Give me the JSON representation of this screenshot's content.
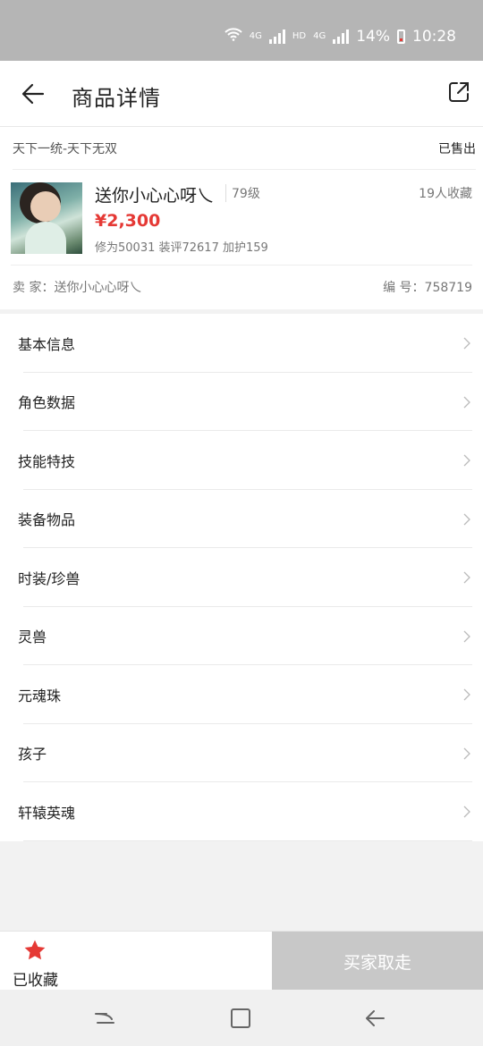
{
  "status_bar": {
    "network1": "4G",
    "hd": "HD",
    "network2": "4G",
    "battery": "14%",
    "time": "10:28"
  },
  "header": {
    "title": "商品详情",
    "back_icon": "arrow-left-icon",
    "share_icon": "share-external-icon"
  },
  "listing": {
    "server": "天下一统-天下无双",
    "status": "已售出",
    "name": "送你小心心呀乀",
    "level": "79级",
    "favorites": "19人收藏",
    "price": "¥2,300",
    "stats": "修为50031  装评72617  加护159",
    "seller": "卖  家：送你小心心呀乀",
    "serial": "编  号：758719"
  },
  "menu": {
    "items": [
      {
        "label": "基本信息"
      },
      {
        "label": "角色数据"
      },
      {
        "label": "技能特技"
      },
      {
        "label": "装备物品"
      },
      {
        "label": "时装/珍兽"
      },
      {
        "label": "灵兽"
      },
      {
        "label": "元魂珠"
      },
      {
        "label": "孩子"
      },
      {
        "label": "轩辕英魂"
      }
    ]
  },
  "actions": {
    "favorite_label": "已收藏",
    "buy_label": "买家取走",
    "accent": "#e53935"
  }
}
